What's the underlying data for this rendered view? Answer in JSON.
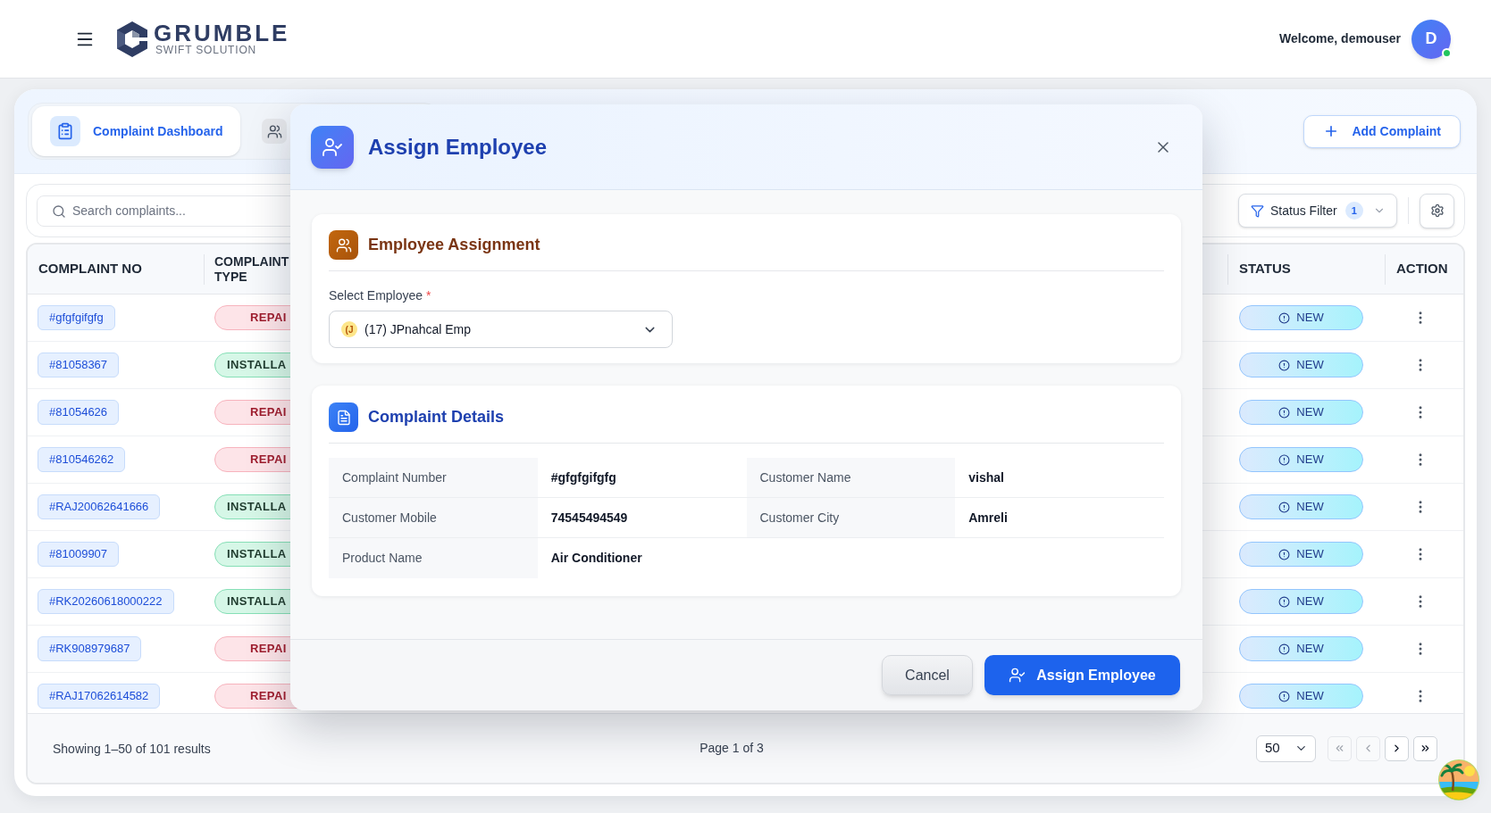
{
  "header": {
    "logo_title": "GRUMBLE",
    "logo_subtitle": "SWIFT SOLUTION",
    "welcome": "Welcome, demouser",
    "avatar_initial": "D",
    "online": true
  },
  "tabs": [
    {
      "label": "Complaint Dashboard",
      "selected": true
    },
    {
      "selected": false
    }
  ],
  "add_button": "Add Complaint",
  "search": {
    "placeholder": "Search complaints..."
  },
  "status_filter": {
    "label": "Status Filter",
    "count": "1"
  },
  "table": {
    "columns": [
      "COMPLAINT NO",
      "COMPLAINT TYPE",
      "STATUS",
      "ACTION"
    ],
    "rows": [
      {
        "complaint_no": "#gfgfgifgfg",
        "type": {
          "kind": "repair",
          "label": "REPAI"
        },
        "status": "NEW"
      },
      {
        "complaint_no": "#81058367",
        "type": {
          "kind": "installation",
          "label": "INSTALLA"
        },
        "status": "NEW"
      },
      {
        "complaint_no": "#81054626",
        "type": {
          "kind": "repair",
          "label": "REPAI"
        },
        "status": "NEW"
      },
      {
        "complaint_no": "#810546262",
        "type": {
          "kind": "repair",
          "label": "REPAI"
        },
        "status": "NEW"
      },
      {
        "complaint_no": "#RAJ20062641666",
        "type": {
          "kind": "installation",
          "label": "INSTALLA"
        },
        "status": "NEW"
      },
      {
        "complaint_no": "#81009907",
        "type": {
          "kind": "installation",
          "label": "INSTALLA"
        },
        "status": "NEW"
      },
      {
        "complaint_no": "#RK20260618000222",
        "type": {
          "kind": "installation",
          "label": "INSTALLA"
        },
        "status": "NEW"
      },
      {
        "complaint_no": "#RK908979687",
        "type": {
          "kind": "repair",
          "label": "REPAI"
        },
        "status": "NEW"
      },
      {
        "complaint_no": "#RAJ17062614582",
        "type": {
          "kind": "repair",
          "label": "REPAI"
        },
        "status": "NEW"
      }
    ]
  },
  "pagination": {
    "summary": "Showing 1–50 of 101 results",
    "page": "Page 1 of 3",
    "page_size": "50",
    "buttons": [
      {
        "kind": "first",
        "disabled": true
      },
      {
        "kind": "prev",
        "disabled": true
      },
      {
        "kind": "next",
        "disabled": false
      },
      {
        "kind": "last",
        "disabled": false
      }
    ]
  },
  "modal": {
    "title": "Assign Employee",
    "assignment": {
      "title": "Employee Assignment",
      "field_label": "Select Employee",
      "required_mark": "*",
      "value_initials": "(J",
      "value": "(17) JPnahcal Emp"
    },
    "details": {
      "title": "Complaint Details",
      "fields": [
        {
          "label": "Complaint Number",
          "value": "#gfgfgifgfg"
        },
        {
          "label": "Customer Name",
          "value": "vishal"
        },
        {
          "label": "Customer Mobile",
          "value": "74545494549"
        },
        {
          "label": "Customer City",
          "value": "Amreli"
        },
        {
          "label": "Product Name",
          "value": "Air Conditioner"
        }
      ]
    },
    "buttons": [
      {
        "kind": "cancel",
        "label": "Cancel"
      },
      {
        "kind": "primary",
        "label": "Assign Employee"
      }
    ]
  }
}
